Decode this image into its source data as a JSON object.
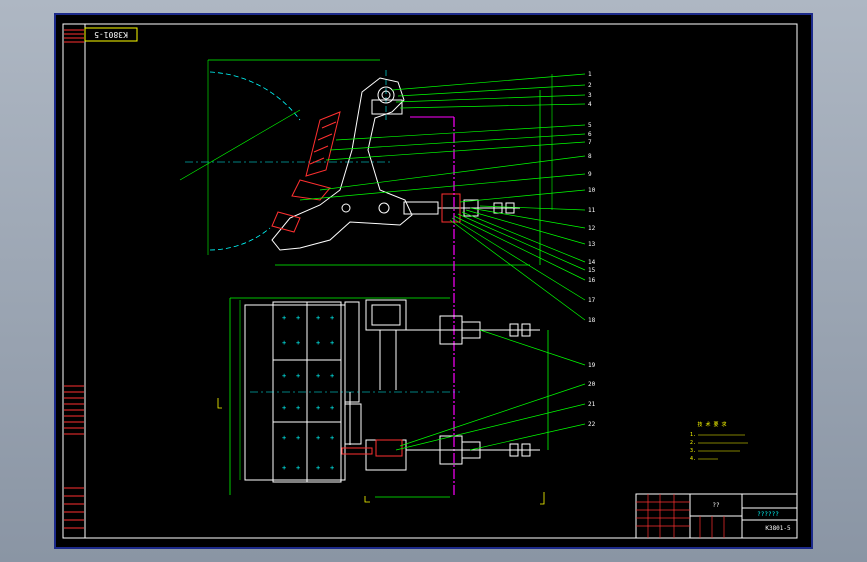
{
  "drawing": {
    "title_stamp": "K3801-5",
    "title_block_name": "??????",
    "title_block_code": "K3801-5",
    "title_block_small": "??",
    "notes_heading": "技 术 要 求",
    "notes_lines": [
      "1.",
      "2.",
      "3.",
      "4."
    ],
    "part_numbers": [
      "1",
      "2",
      "3",
      "4",
      "5",
      "6",
      "7",
      "8",
      "9",
      "10",
      "11",
      "12",
      "13",
      "14",
      "15",
      "16",
      "17",
      "18",
      "19",
      "20",
      "21",
      "22"
    ]
  },
  "colors": {
    "background": "#000000",
    "outline": "#ffffff",
    "leader": "#00ff00",
    "center_line": "#00ffff",
    "hatch": "#ff0000",
    "section": "#ff00ff",
    "notes": "#ffff00",
    "frame_border": "#1c2a8a"
  }
}
